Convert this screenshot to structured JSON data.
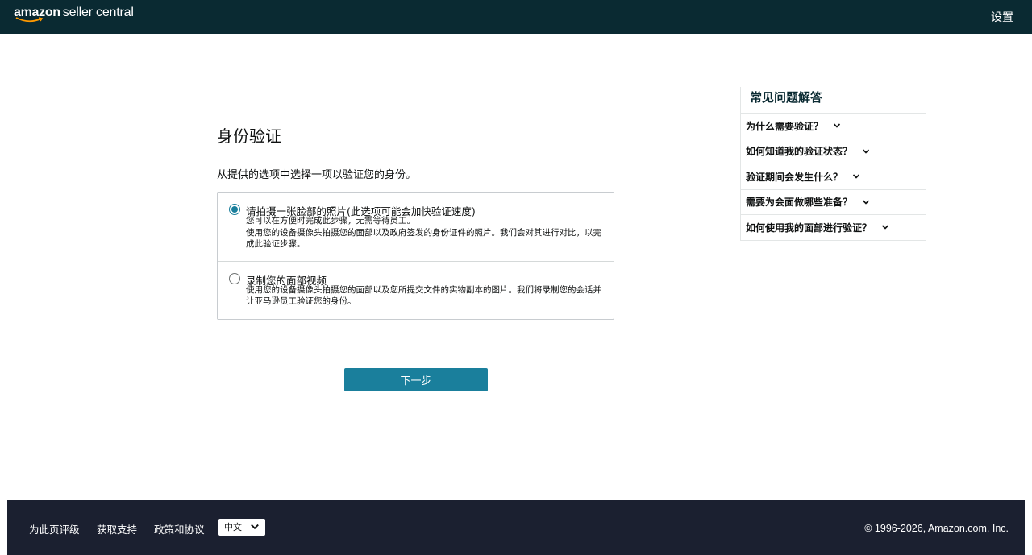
{
  "header": {
    "logo_amazon": "amazon",
    "logo_product": "seller central",
    "settings_label": "设置"
  },
  "main": {
    "title": "身份验证",
    "subtitle": "从提供的选项中选择一项以验证您的身份。",
    "options": [
      {
        "title": "请拍摄一张脸部的照片(此选项可能会加快验证速度)",
        "desc_line1": "您可以在方便时完成此步骤，无需等待员工。",
        "desc_line2": "使用您的设备摄像头拍摄您的面部以及政府签发的身份证件的照片。我们会对其进行对比，以完成此验证步骤。",
        "selected": true
      },
      {
        "title": "录制您的面部视频",
        "desc": "使用您的设备摄像头拍摄您的面部以及您所提交文件的实物副本的图片。我们将录制您的会话并让亚马逊员工验证您的身份。",
        "selected": false
      }
    ],
    "next_button": "下一步"
  },
  "faq": {
    "title": "常见问题解答",
    "items": [
      {
        "label": "为什么需要验证？"
      },
      {
        "label": "如何知道我的验证状态？"
      },
      {
        "label": "验证期间会发生什么？"
      },
      {
        "label": "需要为会面做哪些准备？"
      },
      {
        "label": "如何使用我的面部进行验证？"
      }
    ]
  },
  "footer": {
    "rate_page": "为此页评级",
    "get_support": "获取支持",
    "policies": "政策和协议",
    "language": "中文",
    "copyright": "© 1996-2026, Amazon.com, Inc."
  },
  "colors": {
    "header_bg": "#0a2a32",
    "footer_bg": "#1b2030",
    "accent": "#1a7f9c"
  },
  "icons": [
    "amazon-smile-icon",
    "radio-checked-icon",
    "radio-unchecked-icon",
    "chevron-down-icon"
  ]
}
